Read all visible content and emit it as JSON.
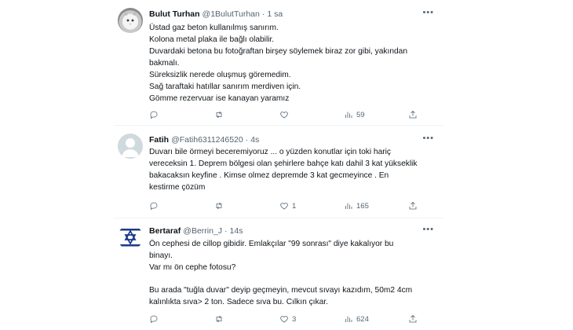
{
  "tweets": [
    {
      "name": "Bulut Turhan",
      "handle": "@1BulutTurhan",
      "time": "1 sa",
      "lines": [
        "Üstad gaz beton kullanılmış sanırım.",
        "Kolona metal plaka ile bağlı olabilir.",
        "Duvardaki betona bu fotoğraftan birşey söylemek biraz zor gibi, yakından",
        "bakmalı.",
        "Süreksizlik nerede oluşmuş göremedim.",
        "Sağ taraftaki hatıllar sanırım merdiven için.",
        "Gömme rezervuar ise kanayan yaramız"
      ],
      "replies": "",
      "retweets": "",
      "likes": "",
      "views": "59"
    },
    {
      "name": "Fatih",
      "handle": "@Fatih6311246520",
      "time": "4s",
      "lines": [
        "Duvarı bile örmeyi beceremiyoruz ... o yüzden konutlar için toki hariç",
        "vereceksin 1. Deprem bölgesi olan şehirlere bahçe katı dahil 3 kat yükseklik",
        "bakacaksın keyfine . Kimse olmez depremde 3 kat gecmeyince . En",
        "kestirme çözüm"
      ],
      "replies": "",
      "retweets": "",
      "likes": "1",
      "views": "165"
    },
    {
      "name": "Bertaraf",
      "handle": "@Berrin_J",
      "time": "14s",
      "lines": [
        "Ön cephesi de cillop gibidir. Emlakçılar \"99 sonrası\" diye kakalıyor bu",
        "binayı.",
        "Var mı ön cephe fotosu?",
        "",
        "Bu arada \"tuğla duvar\" deyip geçmeyin, mevcut sıvayı kazıdım, 50m2 4cm",
        "kalınlıkta sıva> 2 ton. Sadece sıva bu. Cılkın çıkar."
      ],
      "replies": "",
      "retweets": "",
      "likes": "3",
      "views": "624"
    }
  ],
  "icons": {
    "more": "more-options-icon",
    "reply": "reply-icon",
    "retweet": "retweet-icon",
    "like": "like-icon",
    "views": "views-icon",
    "share": "share-icon"
  },
  "colors": {
    "text": "#0f1419",
    "secondary": "#536471",
    "divider": "#eff3f4",
    "star": "#1d3a8a"
  }
}
